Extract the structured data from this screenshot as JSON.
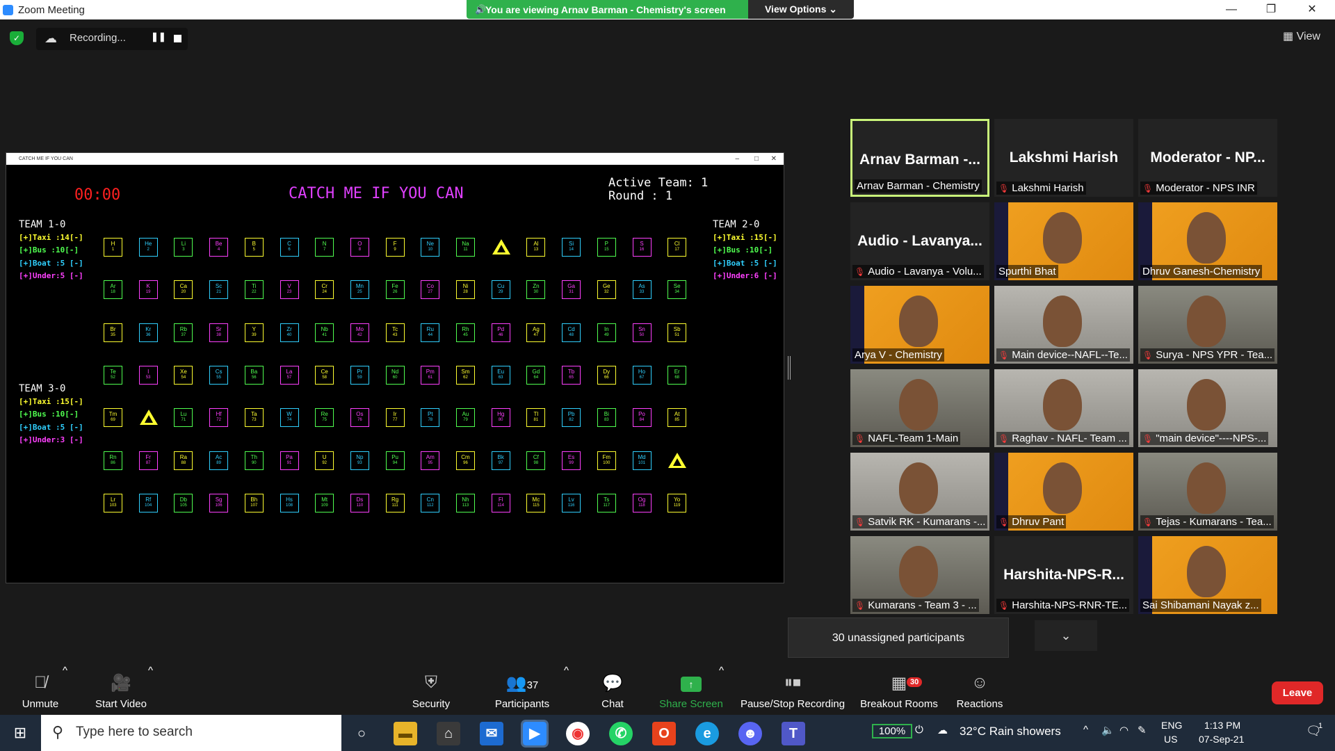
{
  "window": {
    "title": "Zoom Meeting",
    "minimize": "—",
    "restore": "❐",
    "close": "✕"
  },
  "banner": {
    "viewing": "You are viewing Arnav Barman - Chemistry's screen",
    "view_options": "View Options ⌄"
  },
  "recording": {
    "label": "Recording..."
  },
  "view_button": "View",
  "game": {
    "window_title": "CATCH ME IF YOU CAN",
    "timer": "00:00",
    "title": "CATCH ME IF YOU CAN",
    "active_team": "Active Team: 1\nRound : 1",
    "teams": [
      {
        "name": "TEAM 1-0",
        "items": [
          "[+]Taxi :14[-]",
          "[+]Bus  :10[-]",
          "[+]Boat :5 [-]",
          "[+]Under:5 [-]"
        ]
      },
      {
        "name": "TEAM 2-0",
        "items": [
          "[+]Taxi :15[-]",
          "[+]Bus  :10[-]",
          "[+]Boat :5 [-]",
          "[+]Under:6 [-]"
        ]
      },
      {
        "name": "TEAM 3-0",
        "items": [
          "[+]Taxi :15[-]",
          "[+]Bus  :10[-]",
          "[+]Boat :5 [-]",
          "[+]Under:3 [-]"
        ]
      }
    ],
    "rows": [
      [
        "H 1",
        "He 2",
        "Li 3",
        "Be 4",
        "B 5",
        "C 6",
        "N 7",
        "O 8",
        "F 9",
        "Ne 10",
        "Na 11",
        "▲",
        "Al 13",
        "Si 14",
        "P 15",
        "S 16",
        "Cl 17"
      ],
      [
        "Ar 18",
        "K 19",
        "Ca 20",
        "Sc 21",
        "Ti 22",
        "V 23",
        "Cr 24",
        "Mn 25",
        "Fe 26",
        "Co 27",
        "Ni 28",
        "Cu 29",
        "Zn 30",
        "Ga 31",
        "Ge 32",
        "As 33",
        "Se 34"
      ],
      [
        "Br 35",
        "Kr 36",
        "Rb 37",
        "Sr 38",
        "Y 39",
        "Zr 40",
        "Nb 41",
        "Mo 42",
        "Tc 43",
        "Ru 44",
        "Rh 45",
        "Pd 46",
        "Ag 47",
        "Cd 48",
        "In 49",
        "Sn 50",
        "Sb 51"
      ],
      [
        "Te 52",
        "I 53",
        "Xe 54",
        "Cs 55",
        "Ba 56",
        "La 57",
        "Ce 58",
        "Pr 59",
        "Nd 60",
        "Pm 61",
        "Sm 62",
        "Eu 63",
        "Gd 64",
        "Tb 65",
        "Dy 66",
        "Ho 67",
        "Er 68"
      ],
      [
        "Tm 69",
        "▲",
        "Lu 71",
        "Hf 72",
        "Ta 73",
        "W 74",
        "Re 75",
        "Os 76",
        "Ir 77",
        "Pt 78",
        "Au 79",
        "Hg 80",
        "Tl 81",
        "Pb 82",
        "Bi 83",
        "Po 84",
        "At 85"
      ],
      [
        "Rn 86",
        "Fr 87",
        "Ra 88",
        "Ac 89",
        "Th 90",
        "Pa 91",
        "U 92",
        "Np 93",
        "Pu 94",
        "Am 95",
        "Cm 96",
        "Bk 97",
        "Cf 98",
        "Es 99",
        "Fm 100",
        "Md 101",
        "▲"
      ],
      [
        "Lr 103",
        "Rf 104",
        "Db 105",
        "Sg 106",
        "Bh 107",
        "Hs 108",
        "Mt 109",
        "Ds 110",
        "Rg 111",
        "Cn 112",
        "Nh 113",
        "Fl 114",
        "Mc 115",
        "Lv 116",
        "Ts 117",
        "Og 118",
        "Yo 119"
      ]
    ],
    "colors": {
      "yellow": "#ffff30",
      "magenta": "#ff40ff",
      "green": "#50ff50",
      "cyan": "#30d0ff"
    }
  },
  "participants": [
    {
      "big": "Arnav Barman -...",
      "label": "Arnav Barman - Chemistry",
      "muted": false,
      "kind": "name",
      "active": true
    },
    {
      "big": "Lakshmi Harish",
      "label": "Lakshmi Harish",
      "muted": true,
      "kind": "name"
    },
    {
      "big": "Moderator - NP...",
      "label": "Moderator - NPS INR",
      "muted": true,
      "kind": "name"
    },
    {
      "big": "Audio - Lavanya...",
      "label": "Audio - Lavanya - Volu...",
      "muted": true,
      "kind": "name"
    },
    {
      "label": "Spurthi Bhat",
      "muted": false,
      "kind": "orange"
    },
    {
      "label": "Dhruv Ganesh-Chemistry",
      "muted": false,
      "kind": "orange"
    },
    {
      "label": "Arya V - Chemistry",
      "muted": false,
      "kind": "orange"
    },
    {
      "label": "Main device--NAFL--Te...",
      "muted": true,
      "kind": "room2"
    },
    {
      "label": "Surya - NPS YPR - Tea...",
      "muted": true,
      "kind": "room"
    },
    {
      "label": "NAFL-Team 1-Main",
      "muted": true,
      "kind": "room"
    },
    {
      "label": "Raghav - NAFL- Team ...",
      "muted": true,
      "kind": "room2"
    },
    {
      "label": "\"main device\"----NPS-...",
      "muted": true,
      "kind": "room2"
    },
    {
      "label": "Satvik RK - Kumarans -...",
      "muted": true,
      "kind": "room2"
    },
    {
      "label": "Dhruv Pant",
      "muted": true,
      "kind": "orange"
    },
    {
      "label": "Tejas - Kumarans - Tea...",
      "muted": true,
      "kind": "room"
    },
    {
      "label": "Kumarans - Team 3 - ...",
      "muted": true,
      "kind": "room"
    },
    {
      "big": "Harshita-NPS-R...",
      "label": "Harshita-NPS-RNR-TE...",
      "muted": true,
      "kind": "name"
    },
    {
      "label": "Sai Shibamani Nayak z...",
      "muted": false,
      "kind": "orange"
    }
  ],
  "unassigned": "30 unassigned participants",
  "toolbar": {
    "unmute": "Unmute",
    "start_video": "Start Video",
    "security": "Security",
    "participants": "Participants",
    "participants_count": "37",
    "chat": "Chat",
    "share_screen": "Share Screen",
    "pause_stop": "Pause/Stop Recording",
    "breakout": "Breakout Rooms",
    "breakout_count": "30",
    "reactions": "Reactions",
    "leave": "Leave"
  },
  "taskbar": {
    "search_placeholder": "Type here to search",
    "battery": "100%",
    "weather": "32°C  Rain showers",
    "lang": "ENG",
    "region": "US",
    "time": "1:13 PM",
    "date": "07-Sep-21",
    "notifications": "1"
  }
}
